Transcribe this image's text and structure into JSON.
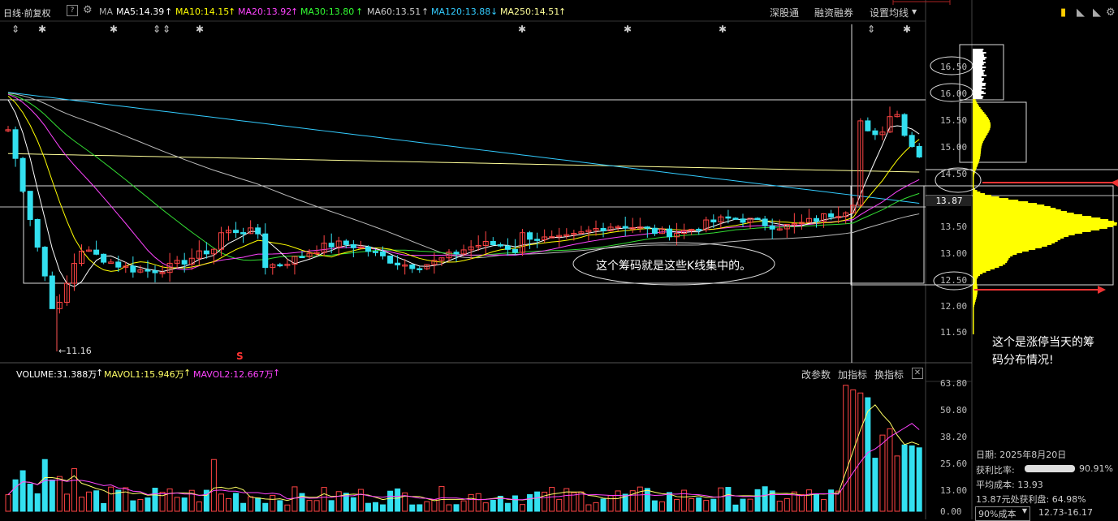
{
  "toolbar": {
    "title": "日线·前复权",
    "help_icon": "question-icon",
    "settings_icon": "gear-icon",
    "ma_label": "MA",
    "ma5": "MA5:14.39",
    "ma10": "MA10:14.15",
    "ma20": "MA20:13.92",
    "ma30": "MA30:13.80",
    "ma60": "MA60:13.51",
    "ma120": "MA120:13.88",
    "ma250": "MA250:14.51",
    "btn_shen": "深股通",
    "btn_rongzi": "融资融券",
    "btn_setup": "设置均线",
    "colors": {
      "ma5": "#ffffff",
      "ma10": "#ffff00",
      "ma20": "#ff44ff",
      "ma30": "#33ff33",
      "ma60": "#bbbbbb",
      "ma120": "#33ccff",
      "ma250": "#ffff88"
    }
  },
  "price_axis": [
    "16.50",
    "16.00",
    "15.50",
    "15.00",
    "14.50",
    "13.87",
    "13.50",
    "13.00",
    "12.50",
    "12.00",
    "11.50"
  ],
  "low_marker": "11.16",
  "s_marker": "S",
  "volume": {
    "label": "VOLUME:31.388万",
    "mavol1": "MAVOL1:15.946万",
    "mavol2": "MAVOL2:12.667万",
    "btn_params": "改参数",
    "btn_add": "加指标",
    "btn_switch": "换指标",
    "axis": [
      "63.80",
      "50.80",
      "38.20",
      "25.60",
      "13.00",
      "0.00"
    ]
  },
  "annotations": {
    "center_bubble": "这个筹码就是这些K线集中的。",
    "right_note_1": "这个是涨停当天的筹",
    "right_note_2": "码分布情况!"
  },
  "chip_info": {
    "date": "日期: 2025年8月20日",
    "profit_ratio_label": "获利比率:",
    "profit_ratio": "90.91%",
    "profit_ratio_fraction": 0.9091,
    "avg_cost": "平均成本: 13.93",
    "profit_at": "13.87元处获利盘: 64.98%",
    "cost_select": "90%成本",
    "cost_range": "12.73-16.17"
  }
}
